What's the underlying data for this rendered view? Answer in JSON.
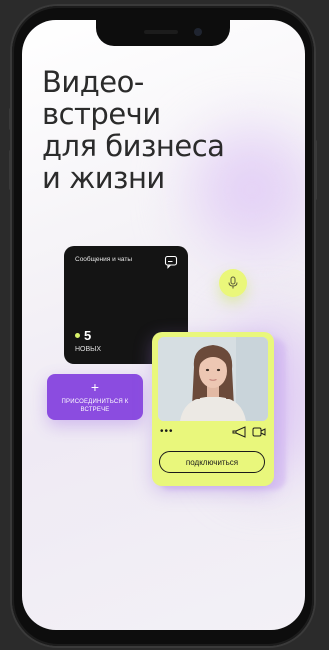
{
  "headline": {
    "line1": "Видео-",
    "line2": "встречи",
    "line3": "для бизнеса",
    "line4": "и жизни"
  },
  "messages_card": {
    "title": "Сообщения и чаты",
    "count": "5",
    "count_label": "НОВЫХ",
    "icon": "chat-icon"
  },
  "mic": {
    "icon": "microphone-icon"
  },
  "join_button": {
    "plus": "+",
    "label": "ПРИСОЕДИНИТЬСЯ К ВСТРЕЧЕ"
  },
  "video_card": {
    "dots": "•••",
    "connect_label": "подключиться",
    "icons": [
      "megaphone-icon",
      "video-camera-icon"
    ]
  },
  "colors": {
    "accent_lime": "#e9f77c",
    "accent_purple": "#8b4ce0",
    "dark_card": "#141414"
  }
}
